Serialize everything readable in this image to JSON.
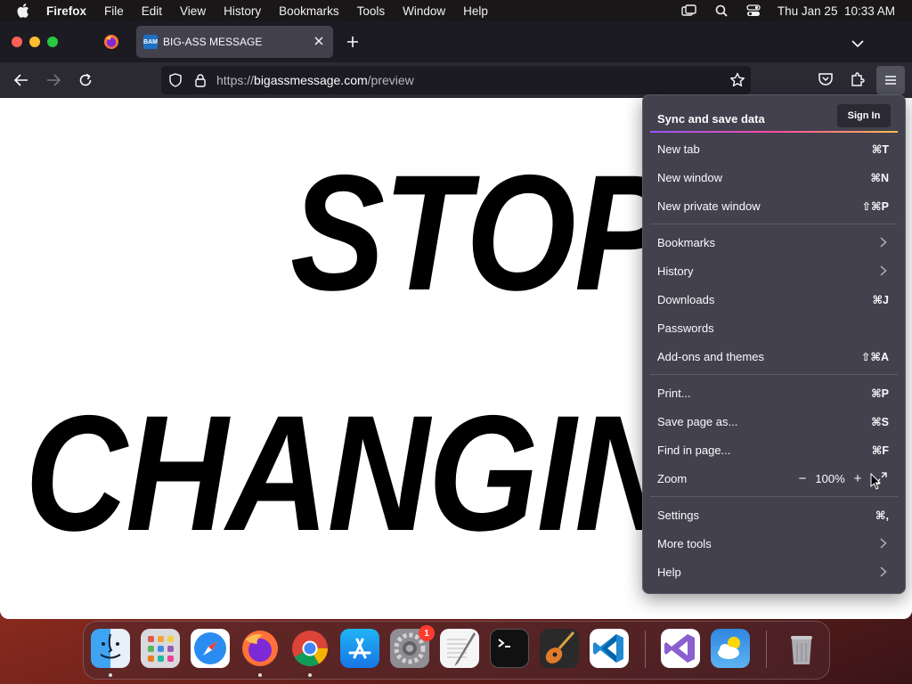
{
  "menubar": {
    "app_name": "Firefox",
    "menus": [
      "File",
      "Edit",
      "View",
      "History",
      "Bookmarks",
      "Tools",
      "Window",
      "Help"
    ],
    "datetime": "Thu Jan 25  10:33 AM"
  },
  "browser": {
    "tab": {
      "title": "BIG-ASS MESSAGE",
      "favicon_text": "BAM"
    },
    "url": {
      "prefix": "https://",
      "host": "bigassmessage.com",
      "path": "/preview"
    }
  },
  "page": {
    "word1": "STOP",
    "word2": "CHANGIN"
  },
  "appmenu": {
    "sync_title": "Sync and save data",
    "sign_in": "Sign In",
    "items": {
      "new_tab": {
        "label": "New tab",
        "shortcut": "⌘T"
      },
      "new_window": {
        "label": "New window",
        "shortcut": "⌘N"
      },
      "new_private_window": {
        "label": "New private window",
        "shortcut": "⇧⌘P"
      },
      "bookmarks": {
        "label": "Bookmarks"
      },
      "history": {
        "label": "History"
      },
      "downloads": {
        "label": "Downloads",
        "shortcut": "⌘J"
      },
      "passwords": {
        "label": "Passwords"
      },
      "addons": {
        "label": "Add-ons and themes",
        "shortcut": "⇧⌘A"
      },
      "print": {
        "label": "Print...",
        "shortcut": "⌘P"
      },
      "save_page": {
        "label": "Save page as...",
        "shortcut": "⌘S"
      },
      "find": {
        "label": "Find in page...",
        "shortcut": "⌘F"
      },
      "zoom": {
        "label": "Zoom",
        "value": "100%",
        "minus": "−",
        "plus": "+"
      },
      "settings": {
        "label": "Settings",
        "shortcut": "⌘,"
      },
      "more_tools": {
        "label": "More tools"
      },
      "help": {
        "label": "Help"
      }
    }
  },
  "dock": {
    "badge_count": "1"
  },
  "colors": {
    "menu_bg": "#42414d",
    "toolbar_bg": "#2b2a33",
    "tabstrip_bg": "#1c1b22",
    "accent_gradient": [
      "#9059ff",
      "#ff4aa2",
      "#ffbd4f"
    ]
  }
}
